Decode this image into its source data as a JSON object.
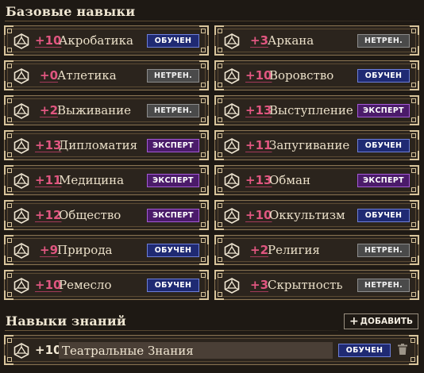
{
  "basic_skills": {
    "title": "Базовые навыки",
    "items": [
      {
        "mod": "+10",
        "name": "Акробатика",
        "rank": "ОБУЧЕН",
        "rank_type": "trained"
      },
      {
        "mod": "+3",
        "name": "Аркана",
        "rank": "НЕТРЕН.",
        "rank_type": "untrained"
      },
      {
        "mod": "+0",
        "name": "Атлетика",
        "rank": "НЕТРЕН.",
        "rank_type": "untrained"
      },
      {
        "mod": "+10",
        "name": "Воровство",
        "rank": "ОБУЧЕН",
        "rank_type": "trained"
      },
      {
        "mod": "+2",
        "name": "Выживание",
        "rank": "НЕТРЕН.",
        "rank_type": "untrained"
      },
      {
        "mod": "+13",
        "name": "Выступление",
        "rank": "ЭКСПЕРТ",
        "rank_type": "expert"
      },
      {
        "mod": "+13",
        "name": "Дипломатия",
        "rank": "ЭКСПЕРТ",
        "rank_type": "expert"
      },
      {
        "mod": "+11",
        "name": "Запугивание",
        "rank": "ОБУЧЕН",
        "rank_type": "trained"
      },
      {
        "mod": "+11",
        "name": "Медицина",
        "rank": "ЭКСПЕРТ",
        "rank_type": "expert"
      },
      {
        "mod": "+13",
        "name": "Обман",
        "rank": "ЭКСПЕРТ",
        "rank_type": "expert"
      },
      {
        "mod": "+12",
        "name": "Общество",
        "rank": "ЭКСПЕРТ",
        "rank_type": "expert"
      },
      {
        "mod": "+10",
        "name": "Оккультизм",
        "rank": "ОБУЧЕН",
        "rank_type": "trained"
      },
      {
        "mod": "+9",
        "name": "Природа",
        "rank": "ОБУЧЕН",
        "rank_type": "trained"
      },
      {
        "mod": "+2",
        "name": "Религия",
        "rank": "НЕТРЕН.",
        "rank_type": "untrained"
      },
      {
        "mod": "+10",
        "name": "Ремесло",
        "rank": "ОБУЧЕН",
        "rank_type": "trained"
      },
      {
        "mod": "+3",
        "name": "Скрытность",
        "rank": "НЕТРЕН.",
        "rank_type": "untrained"
      }
    ]
  },
  "lore_skills": {
    "title": "Навыки знаний",
    "add_label": "ДОБАВИТЬ",
    "items": [
      {
        "mod": "+10",
        "name": "Театральные Знания",
        "rank": "ОБУЧЕН",
        "rank_type": "trained"
      }
    ]
  },
  "icons": {
    "roll": "d20-icon",
    "add": "plus-icon",
    "delete": "trash-icon"
  },
  "colors": {
    "modifier": "#e05680",
    "trained": "#1f2a73",
    "untrained": "#4a4a4a",
    "expert": "#4b1b6a",
    "frame": "#d8c49b"
  }
}
